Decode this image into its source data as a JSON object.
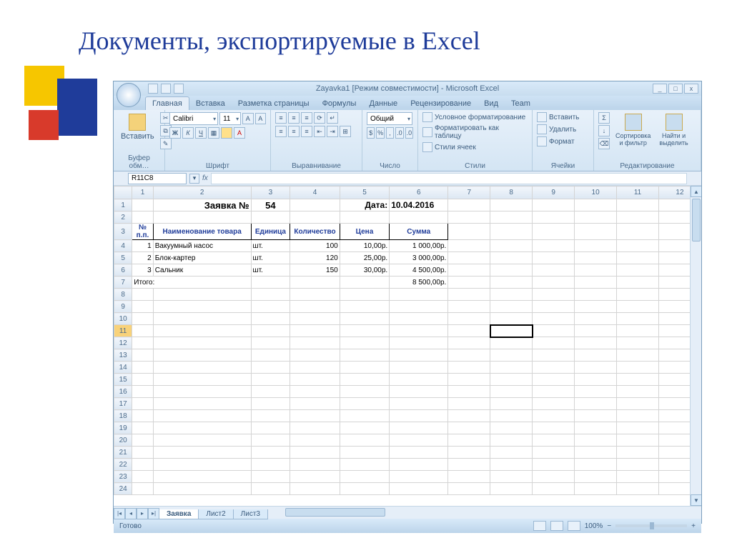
{
  "slide": {
    "title": "Документы, экспортируемые в Excel"
  },
  "window": {
    "title": "Zayavka1 [Режим совместимости] - Microsoft Excel",
    "min": "_",
    "max": "□",
    "close": "x"
  },
  "tabs": {
    "t1": "Главная",
    "t2": "Вставка",
    "t3": "Разметка страницы",
    "t4": "Формулы",
    "t5": "Данные",
    "t6": "Рецензирование",
    "t7": "Вид",
    "t8": "Team"
  },
  "ribbon": {
    "paste": "Вставить",
    "g_clip": "Буфер обм…",
    "font_name": "Calibri",
    "font_size": "11",
    "b": "Ж",
    "i": "К",
    "u": "Ч",
    "g_font": "Шрифт",
    "g_align": "Выравнивание",
    "num_format": "Общий",
    "g_num": "Число",
    "cond": "Условное форматирование",
    "fmt_tbl": "Форматировать как таблицу",
    "cell_styles": "Стили ячеек",
    "g_styles": "Стили",
    "ins": "Вставить",
    "del": "Удалить",
    "fmt": "Формат",
    "g_cells": "Ячейки",
    "sort": "Сортировка\nи фильтр",
    "find": "Найти и\nвыделить",
    "g_edit": "Редактирование"
  },
  "namebox": "R11C8",
  "fx": "fx",
  "cols": {
    "c1": "1",
    "c2": "2",
    "c3": "3",
    "c4": "4",
    "c5": "5",
    "c6": "6",
    "c7": "7",
    "c8": "8",
    "c9": "9",
    "c10": "10",
    "c11": "11",
    "c12": "12"
  },
  "rows": {
    "r1": "1",
    "r2": "2",
    "r3": "3",
    "r4": "4",
    "r5": "5",
    "r6": "6",
    "r7": "7",
    "r8": "8",
    "r9": "9",
    "r10": "10",
    "r11": "11",
    "r12": "12",
    "r13": "13",
    "r14": "14",
    "r15": "15",
    "r16": "16",
    "r17": "17",
    "r18": "18",
    "r19": "19",
    "r20": "20",
    "r21": "21",
    "r22": "22",
    "r23": "23",
    "r24": "24"
  },
  "hdr": {
    "title": "Заявка №",
    "num": "54",
    "date_lbl": "Дата:",
    "date": "10.04.2016"
  },
  "th": {
    "n": "№\nп.п.",
    "name": "Наименование товара",
    "unit": "Единица",
    "qty": "Количество",
    "price": "Цена",
    "sum": "Сумма"
  },
  "d": {
    "r1": {
      "n": "1",
      "name": "Вакуумный насос",
      "unit": "шт.",
      "qty": "100",
      "price": "10,00р.",
      "sum": "1 000,00р."
    },
    "r2": {
      "n": "2",
      "name": "Блок-картер",
      "unit": "шт.",
      "qty": "120",
      "price": "25,00р.",
      "sum": "3 000,00р."
    },
    "r3": {
      "n": "3",
      "name": "Сальник",
      "unit": "шт.",
      "qty": "150",
      "price": "30,00р.",
      "sum": "4 500,00р."
    }
  },
  "total": {
    "lbl": "Итого:",
    "sum": "8 500,00р."
  },
  "sheets": {
    "s1": "Заявка",
    "s2": "Лист2",
    "s3": "Лист3"
  },
  "status": {
    "ready": "Готово",
    "zoom": "100%",
    "minus": "−",
    "plus": "+"
  }
}
